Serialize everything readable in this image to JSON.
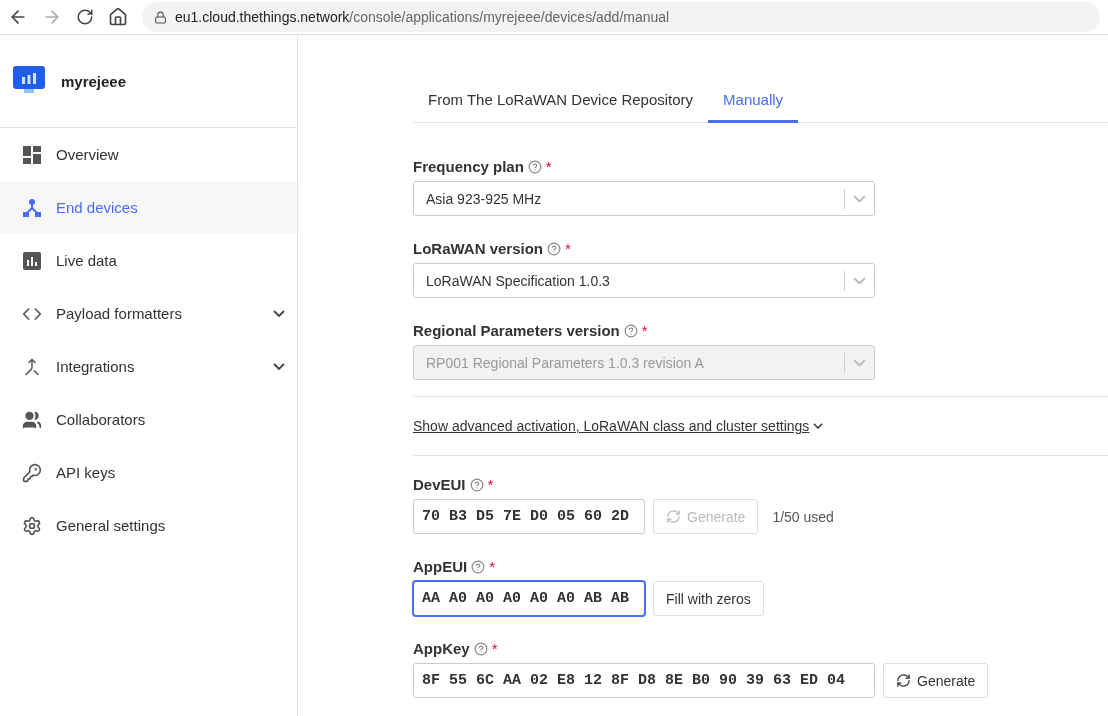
{
  "browser": {
    "url_host": "eu1.cloud.thethings.network",
    "url_path": "/console/applications/myrejeee/devices/add/manual"
  },
  "app": {
    "name": "myrejeee"
  },
  "sidebar": {
    "items": [
      {
        "label": "Overview",
        "selected": false,
        "expandable": false
      },
      {
        "label": "End devices",
        "selected": true,
        "expandable": false
      },
      {
        "label": "Live data",
        "selected": false,
        "expandable": false
      },
      {
        "label": "Payload formatters",
        "selected": false,
        "expandable": true
      },
      {
        "label": "Integrations",
        "selected": false,
        "expandable": true
      },
      {
        "label": "Collaborators",
        "selected": false,
        "expandable": false
      },
      {
        "label": "API keys",
        "selected": false,
        "expandable": false
      },
      {
        "label": "General settings",
        "selected": false,
        "expandable": false
      }
    ]
  },
  "tabs": [
    {
      "label": "From The LoRaWAN Device Repository",
      "selected": false
    },
    {
      "label": "Manually",
      "selected": true
    }
  ],
  "fields": [
    {
      "kind": "select",
      "label": "Frequency plan",
      "required_mark": "*",
      "value": "Asia 923-925 MHz",
      "disabled": false
    },
    {
      "kind": "select",
      "label": "LoRaWAN version",
      "required_mark": "*",
      "value": "LoRaWAN Specification 1.0.3",
      "disabled": false
    },
    {
      "kind": "select",
      "label": "Regional Parameters version",
      "required_mark": "*",
      "value": "RP001 Regional Parameters 1.0.3 revision A",
      "disabled": true
    },
    {
      "kind": "toggle",
      "label": "Show advanced activation, LoRaWAN class and cluster settings",
      "expanded": false
    },
    {
      "kind": "input",
      "label": "DevEUI",
      "required_mark": "*",
      "value": "70 B3 D5 7E D0 05 60 2D",
      "focused": false,
      "wide": false,
      "button": {
        "label": "Generate",
        "with_icon": true,
        "disabled": true
      },
      "note": "1/50 used"
    },
    {
      "kind": "input",
      "label": "AppEUI",
      "required_mark": "*",
      "value": "AA A0 A0 A0 A0 A0 AB AB",
      "focused": true,
      "wide": false,
      "button": {
        "label": "Fill with zeros",
        "with_icon": false,
        "disabled": false
      }
    },
    {
      "kind": "input",
      "label": "AppKey",
      "required_mark": "*",
      "value": "8F 55 6C AA 02 E8 12 8F D8 8E B0 90 39 63 ED 04",
      "focused": false,
      "wide": true,
      "button": {
        "label": "Generate",
        "with_icon": true,
        "disabled": false
      }
    }
  ]
}
